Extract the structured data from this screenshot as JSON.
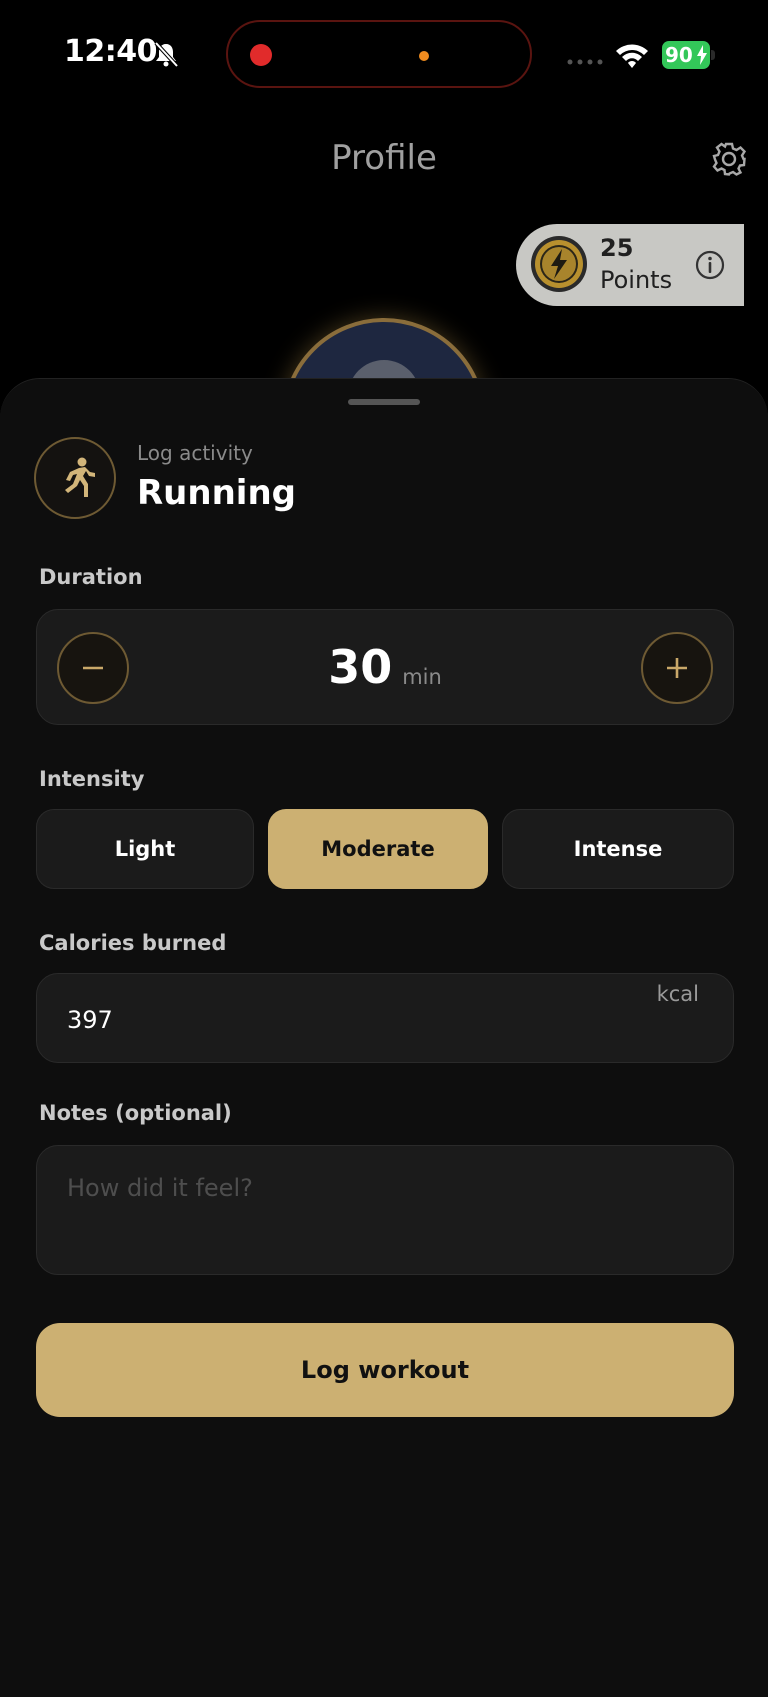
{
  "status_bar": {
    "time": "12:40",
    "battery": "90"
  },
  "header": {
    "title": "Profile"
  },
  "points": {
    "value": "25",
    "label": "Points"
  },
  "sheet": {
    "eyebrow": "Log activity",
    "activity": "Running",
    "duration": {
      "label": "Duration",
      "value": "30",
      "unit": "min"
    },
    "intensity": {
      "label": "Intensity",
      "options": [
        "Light",
        "Moderate",
        "Intense"
      ],
      "selected": "Moderate"
    },
    "calories": {
      "label": "Calories burned",
      "value": "397",
      "unit": "kcal"
    },
    "notes": {
      "label": "Notes (optional)",
      "placeholder": "How did it feel?"
    },
    "submit_label": "Log workout"
  },
  "colors": {
    "accent": "#ccb072",
    "surface": "#1b1b1b",
    "sheet": "#0e0e0e",
    "battery": "#33c759"
  },
  "icons": [
    "bell-muted-icon",
    "wifi-icon",
    "gear-icon",
    "coin-icon",
    "info-icon",
    "runner-icon",
    "minus-icon",
    "plus-icon"
  ]
}
